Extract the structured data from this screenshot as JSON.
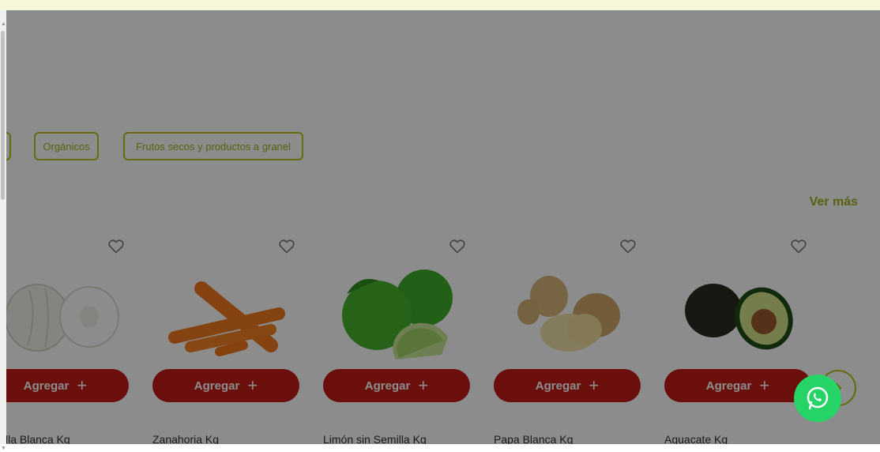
{
  "categories": [
    {
      "label": "Orgánicos"
    },
    {
      "label": "Frutos secos y productos a granel"
    }
  ],
  "see_more": "Ver más",
  "products": [
    {
      "name": "lla Blanca Kg",
      "button_label": "Agregar"
    },
    {
      "name": "Zanahoria Kg",
      "button_label": "Agregar"
    },
    {
      "name": "Limón sin Semilla Kg",
      "button_label": "Agregar"
    },
    {
      "name": "Papa Blanca Kg",
      "button_label": "Agregar"
    },
    {
      "name": "Aguacate Kg",
      "button_label": "Agregar"
    }
  ],
  "colors": {
    "accent": "#b8c41a",
    "button": "#c41c17",
    "overlay": "rgba(0,0,0,0.45)",
    "whatsapp": "#25d366"
  },
  "icons": [
    "heart-icon",
    "plus-icon",
    "chevron-right-icon",
    "whatsapp-icon"
  ]
}
